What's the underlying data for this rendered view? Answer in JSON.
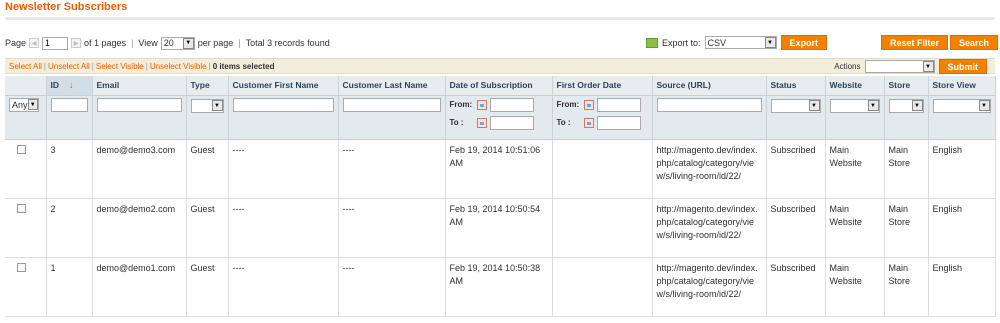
{
  "page": {
    "title": "Newsletter Subscribers"
  },
  "pager": {
    "page_label": "Page",
    "page_value": "1",
    "of_pages": "of 1 pages",
    "view_label": "View",
    "per_page": "20",
    "per_page_label": "per page",
    "total": "Total 3 records found"
  },
  "export": {
    "label": "Export to:",
    "format": "CSV",
    "button": "Export"
  },
  "buttons": {
    "reset_filter": "Reset Filter",
    "search": "Search"
  },
  "massaction": {
    "select_all": "Select All",
    "unselect_all": "Unselect All",
    "select_visible": "Select Visible",
    "unselect_visible": "Unselect Visible",
    "selected_count": "0 items selected",
    "actions_label": "Actions",
    "submit": "Submit"
  },
  "columns": [
    "",
    "ID",
    "Email",
    "Type",
    "Customer First Name",
    "Customer Last Name",
    "Date of Subscription",
    "First Order Date",
    "Source (URL)",
    "Status",
    "Website",
    "Store",
    "Store View"
  ],
  "filters": {
    "any": "Any",
    "from": "From:",
    "to": "To :"
  },
  "rows": [
    {
      "id": "3",
      "email": "demo@demo3.com",
      "type": "Guest",
      "first": "----",
      "last": "----",
      "date": "Feb 19, 2014 10:51:06 AM",
      "first_order": "",
      "source": "http://magento.dev/index.php/catalog/category/view/s/living-room/id/22/",
      "status": "Subscribed",
      "website": "Main Website",
      "store": "Main Store",
      "store_view": "English"
    },
    {
      "id": "2",
      "email": "demo@demo2.com",
      "type": "Guest",
      "first": "----",
      "last": "----",
      "date": "Feb 19, 2014 10:50:54 AM",
      "first_order": "",
      "source": "http://magento.dev/index.php/catalog/category/view/s/living-room/id/22/",
      "status": "Subscribed",
      "website": "Main Website",
      "store": "Main Store",
      "store_view": "English"
    },
    {
      "id": "1",
      "email": "demo@demo1.com",
      "type": "Guest",
      "first": "----",
      "last": "----",
      "date": "Feb 19, 2014 10:50:38 AM",
      "first_order": "",
      "source": "http://magento.dev/index.php/catalog/category/view/s/living-room/id/22/",
      "status": "Subscribed",
      "website": "Main Website",
      "store": "Main Store",
      "store_view": "English"
    }
  ]
}
